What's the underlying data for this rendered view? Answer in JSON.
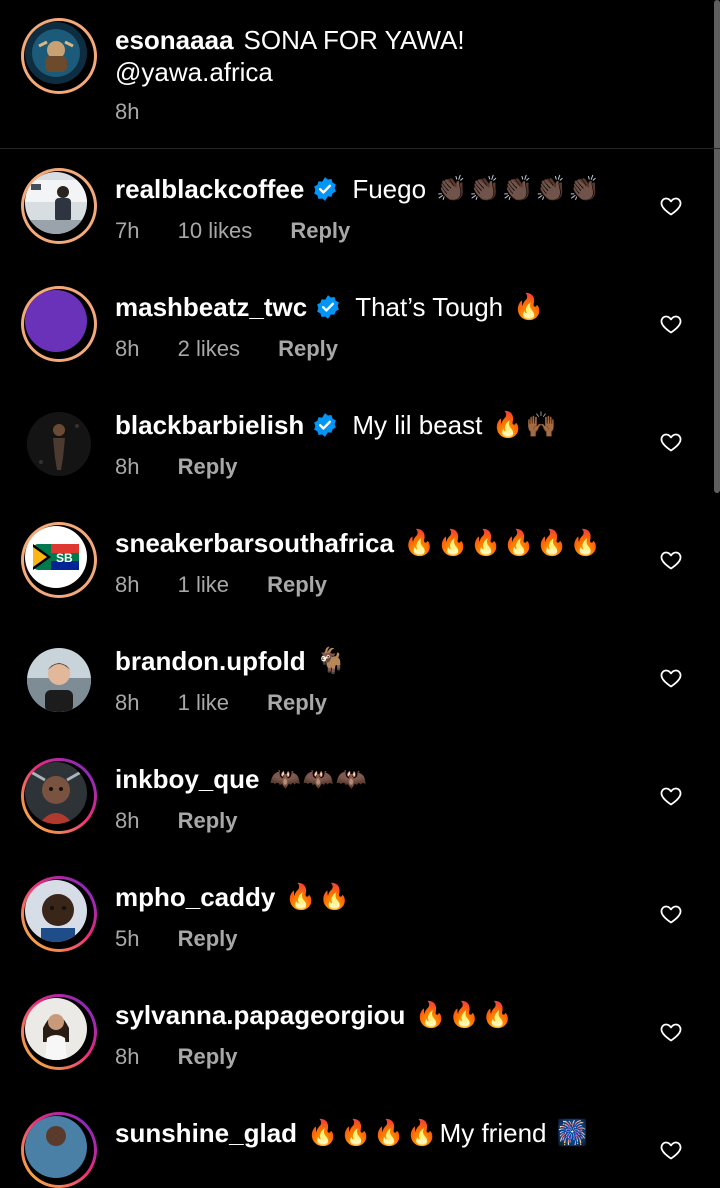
{
  "caption": {
    "username": "esonaaaa",
    "text": "SONA FOR YAWA!",
    "mention": "@yawa.africa",
    "time": "8h"
  },
  "comments": [
    {
      "username": "realblackcoffee",
      "verified": true,
      "text": "Fuego",
      "emoji": "👏🏿👏🏿👏🏿👏🏿👏🏿",
      "time": "7h",
      "likes": "10 likes",
      "reply": "Reply"
    },
    {
      "username": "mashbeatz_twc",
      "verified": true,
      "text": "That’s Tough",
      "emoji": "🔥",
      "time": "8h",
      "likes": "2 likes",
      "reply": "Reply"
    },
    {
      "username": "blackbarbielish",
      "verified": true,
      "text": "My lil beast",
      "emoji": "🔥🙌🏾",
      "time": "8h",
      "likes": "",
      "reply": "Reply"
    },
    {
      "username": "sneakerbarsouthafrica",
      "verified": false,
      "text": "",
      "emoji": "🔥🔥🔥🔥🔥🔥",
      "time": "8h",
      "likes": "1 like",
      "reply": "Reply"
    },
    {
      "username": "brandon.upfold",
      "verified": false,
      "text": "",
      "emoji": "🐐",
      "time": "8h",
      "likes": "1 like",
      "reply": "Reply"
    },
    {
      "username": "inkboy_que",
      "verified": false,
      "text": "",
      "emoji": "🦇🦇🦇",
      "time": "8h",
      "likes": "",
      "reply": "Reply"
    },
    {
      "username": "mpho_caddy",
      "verified": false,
      "text": "",
      "emoji": "🔥🔥",
      "time": "5h",
      "likes": "",
      "reply": "Reply"
    },
    {
      "username": "sylvanna.papageorgiou",
      "verified": false,
      "text": "",
      "emoji": "🔥🔥🔥",
      "time": "8h",
      "likes": "",
      "reply": "Reply"
    },
    {
      "username": "sunshine_glad",
      "verified": false,
      "text": "My friend",
      "emoji": "🔥🔥🔥🔥",
      "emoji_after": "🎆",
      "time": "",
      "likes": "",
      "reply": ""
    }
  ],
  "icons": {
    "heart": "heart-outline-icon",
    "verified": "verified-badge-icon"
  },
  "colors": {
    "background": "#000000",
    "meta": "#a8a8a8",
    "verified": "#0095f6",
    "divider": "#262626"
  }
}
